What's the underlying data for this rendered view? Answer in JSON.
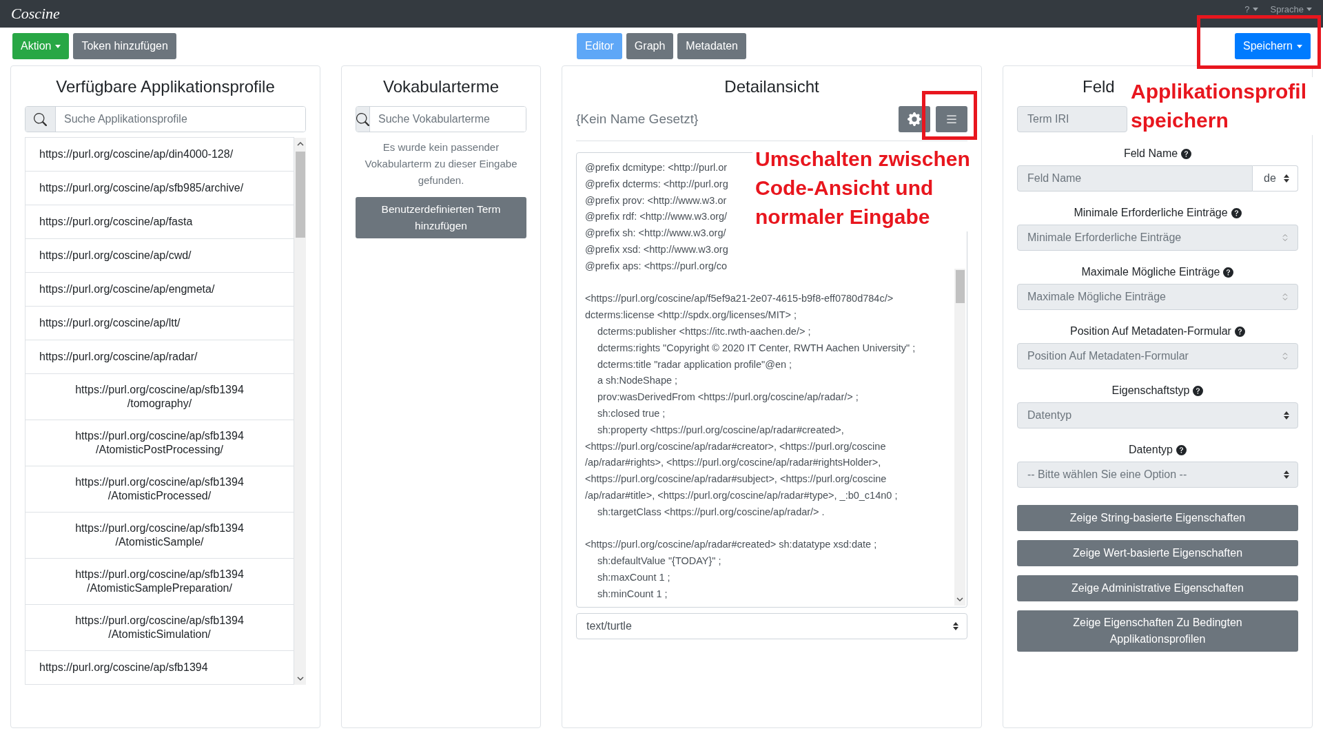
{
  "navbar": {
    "logo": "Coscine",
    "menus": [
      {
        "label": "?"
      },
      {
        "label": "Sprache"
      }
    ]
  },
  "toolbar": {
    "left_buttons": [
      {
        "label": "Aktion",
        "kind": "success",
        "dropdown": true
      },
      {
        "label": "Token hinzufügen",
        "kind": "secondary",
        "dropdown": false
      }
    ],
    "tabs": [
      {
        "label": "Editor",
        "selected": true
      },
      {
        "label": "Graph",
        "selected": false
      },
      {
        "label": "Metadaten",
        "selected": false
      }
    ],
    "save_button": {
      "label": "Speichern",
      "dropdown": true
    }
  },
  "profiles_panel": {
    "title": "Verfügbare Applikationsprofile",
    "search": {
      "placeholder": "Suche Applikationsprofile"
    },
    "items": [
      {
        "lines": [
          "https://purl.org/coscine/ap/din4000-128/"
        ]
      },
      {
        "lines": [
          "https://purl.org/coscine/ap/sfb985/archive/"
        ]
      },
      {
        "lines": [
          "https://purl.org/coscine/ap/fasta"
        ]
      },
      {
        "lines": [
          "https://purl.org/coscine/ap/cwd/"
        ]
      },
      {
        "lines": [
          "https://purl.org/coscine/ap/engmeta/"
        ]
      },
      {
        "lines": [
          "https://purl.org/coscine/ap/ltt/"
        ]
      },
      {
        "lines": [
          "https://purl.org/coscine/ap/radar/"
        ]
      },
      {
        "lines": [
          "https://purl.org/coscine/ap/sfb1394",
          "/tomography/"
        ]
      },
      {
        "lines": [
          "https://purl.org/coscine/ap/sfb1394",
          "/AtomisticPostProcessing/"
        ]
      },
      {
        "lines": [
          "https://purl.org/coscine/ap/sfb1394",
          "/AtomisticProcessed/"
        ]
      },
      {
        "lines": [
          "https://purl.org/coscine/ap/sfb1394",
          "/AtomisticSample/"
        ]
      },
      {
        "lines": [
          "https://purl.org/coscine/ap/sfb1394",
          "/AtomisticSamplePreparation/"
        ]
      },
      {
        "lines": [
          "https://purl.org/coscine/ap/sfb1394",
          "/AtomisticSimulation/"
        ]
      },
      {
        "lines": [
          "https://purl.org/coscine/ap/sfb1394"
        ]
      }
    ]
  },
  "vocabulary_panel": {
    "title": "Vokabularterme",
    "search": {
      "placeholder": "Suche Vokabularterme"
    },
    "message": "Es wurde kein passender Vokabularterm zu dieser Eingabe gefunden.",
    "button": "Benutzerdefinierten Term hinzufügen"
  },
  "detail_panel": {
    "title": "Detailansicht",
    "name": "{Kein Name Gesetzt}",
    "code_lines": [
      {
        "kind": "code",
        "text": "@prefix dcmitype: <http://purl.or",
        "indented": false
      },
      {
        "kind": "code",
        "text": "@prefix dcterms: <http://purl.org",
        "indented": false
      },
      {
        "kind": "code",
        "text": "@prefix prov: <http://www.w3.or",
        "indented": false
      },
      {
        "kind": "code",
        "text": "@prefix rdf: <http://www.w3.org/",
        "indented": false
      },
      {
        "kind": "code",
        "text": "@prefix sh: <http://www.w3.org/",
        "indented": false
      },
      {
        "kind": "code",
        "text": "@prefix xsd: <http://www.w3.org",
        "indented": false
      },
      {
        "kind": "code",
        "text": "@prefix aps: <https://purl.org/co",
        "indented": false
      },
      {
        "kind": "blank"
      },
      {
        "kind": "code",
        "text": "<https://purl.org/coscine/ap/f5ef9a21-2e07-4615-b9f8-eff0780d784c/>",
        "indented": false
      },
      {
        "kind": "code",
        "text": "dcterms:license <http://spdx.org/licenses/MIT> ;",
        "indented": false
      },
      {
        "kind": "code",
        "text": "dcterms:publisher <https://itc.rwth-aachen.de/> ;",
        "indented": true
      },
      {
        "kind": "code",
        "text": "dcterms:rights \"Copyright © 2020 IT Center, RWTH Aachen University\" ;",
        "indented": true
      },
      {
        "kind": "code",
        "text": "dcterms:title \"radar application profile\"@en ;",
        "indented": true
      },
      {
        "kind": "code",
        "text": "a sh:NodeShape ;",
        "indented": true
      },
      {
        "kind": "code",
        "text": "prov:wasDerivedFrom <https://purl.org/coscine/ap/radar/> ;",
        "indented": true
      },
      {
        "kind": "code",
        "text": "sh:closed true ;",
        "indented": true
      },
      {
        "kind": "code",
        "text": "sh:property <https://purl.org/coscine/ap/radar#created>,",
        "indented": true
      },
      {
        "kind": "code",
        "text": "<https://purl.org/coscine/ap/radar#creator>, <https://purl.org/coscine",
        "indented": false
      },
      {
        "kind": "code",
        "text": "/ap/radar#rights>, <https://purl.org/coscine/ap/radar#rightsHolder>,",
        "indented": false
      },
      {
        "kind": "code",
        "text": "<https://purl.org/coscine/ap/radar#subject>, <https://purl.org/coscine",
        "indented": false
      },
      {
        "kind": "code",
        "text": "/ap/radar#title>, <https://purl.org/coscine/ap/radar#type>, _:b0_c14n0 ;",
        "indented": false
      },
      {
        "kind": "code",
        "text": "sh:targetClass <https://purl.org/coscine/ap/radar/> .",
        "indented": true
      },
      {
        "kind": "blank"
      },
      {
        "kind": "code",
        "text": "<https://purl.org/coscine/ap/radar#created> sh:datatype xsd:date ;",
        "indented": false
      },
      {
        "kind": "code",
        "text": "sh:defaultValue \"{TODAY}\" ;",
        "indented": true
      },
      {
        "kind": "code",
        "text": "sh:maxCount 1 ;",
        "indented": true
      },
      {
        "kind": "code",
        "text": "sh:minCount 1 ;",
        "indented": true
      }
    ],
    "format": {
      "value": "text/turtle"
    }
  },
  "field_panel": {
    "title": "Feld",
    "fields": [
      {
        "kind": "text",
        "placeholder": "Term IRI",
        "disabled": true
      },
      {
        "kind": "text_lang",
        "label": "Feld Name",
        "placeholder": "Feld Name",
        "language": "de",
        "disabled": true
      },
      {
        "kind": "number",
        "label": "Minimale Erforderliche Einträge",
        "placeholder": "Minimale Erforderliche Einträge",
        "disabled": true
      },
      {
        "kind": "number",
        "label": "Maximale Mögliche Einträge",
        "placeholder": "Maximale Mögliche Einträge",
        "disabled": true
      },
      {
        "kind": "number",
        "label": "Position Auf Metadaten-Formular",
        "placeholder": "Position Auf Metadaten-Formular",
        "disabled": true
      },
      {
        "kind": "select",
        "label": "Eigenschaftstyp",
        "value": "Datentyp",
        "disabled": true
      },
      {
        "kind": "select",
        "label": "Datentyp",
        "value": "-- Bitte wählen Sie eine Option --",
        "disabled": true
      }
    ],
    "buttons": [
      "Zeige String-basierte Eigenschaften",
      "Zeige Wert-basierte Eigenschaften",
      "Zeige Administrative Eigenschaften",
      "Zeige Eigenschaften Zu Bedingten Applikationsprofilen"
    ]
  },
  "annotations": [
    {
      "text": "Umschalten zwischen Code-Ansicht und normaler Eingabe"
    },
    {
      "text": "Applikationsprofil speichern"
    }
  ]
}
